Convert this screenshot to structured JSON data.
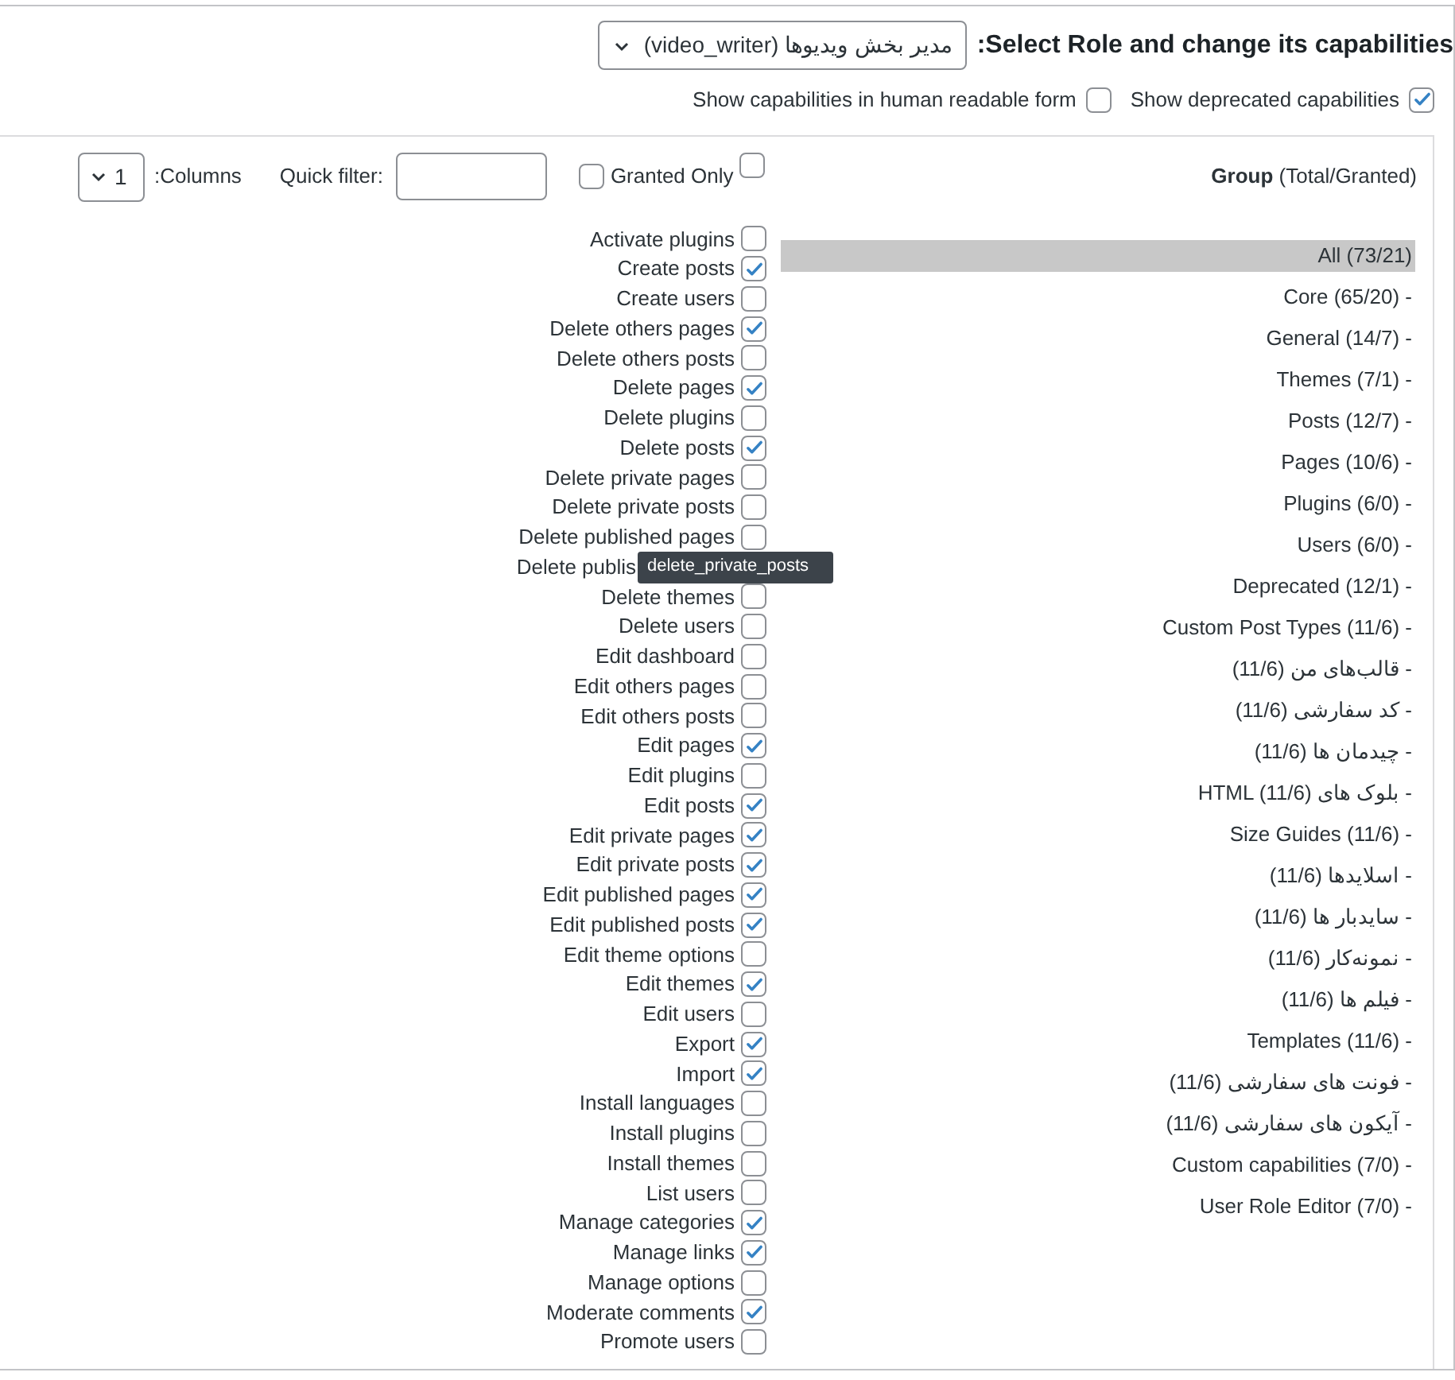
{
  "header": {
    "title": "Select Role and change its capabilities:",
    "role_select": {
      "value": "مدیر بخش ویدیوها (video_writer)"
    },
    "options": [
      {
        "label": "Show capabilities in human readable form",
        "checked": false
      },
      {
        "label": "Show deprecated capabilities",
        "checked": true
      }
    ]
  },
  "toolbar": {
    "group_heading": {
      "bold": "Group",
      "rest": "(Total/Granted)"
    },
    "column_checkbox": {
      "checked": false
    },
    "granted_only": {
      "label": "Granted Only",
      "checked": false
    },
    "quick_filter": {
      "label": "Quick filter:"
    },
    "columns": {
      "label": "Columns:",
      "value": "1"
    }
  },
  "groups": [
    {
      "label": "All (73/21)",
      "selected": true
    },
    {
      "label": "- Core (65/20)",
      "selected": false
    },
    {
      "label": "- General (14/7)",
      "selected": false
    },
    {
      "label": "- Themes (7/1)",
      "selected": false
    },
    {
      "label": "- Posts (12/7)",
      "selected": false
    },
    {
      "label": "- Pages (10/6)",
      "selected": false
    },
    {
      "label": "- Plugins (6/0)",
      "selected": false
    },
    {
      "label": "- Users (6/0)",
      "selected": false
    },
    {
      "label": "- Deprecated (12/1)",
      "selected": false
    },
    {
      "label": "- Custom Post Types (11/6)",
      "selected": false
    },
    {
      "label": "- قالب‌های من (11/6)",
      "selected": false
    },
    {
      "label": "- کد سفارشی (11/6)",
      "selected": false
    },
    {
      "label": "- چیدمان ها (11/6)",
      "selected": false
    },
    {
      "label": "- بلوک های HTML (11/6)",
      "selected": false
    },
    {
      "label": "- Size Guides (11/6)",
      "selected": false
    },
    {
      "label": "- اسلایدها (11/6)",
      "selected": false
    },
    {
      "label": "- سایدبار ها (11/6)",
      "selected": false
    },
    {
      "label": "- نمونه‌کار (11/6)",
      "selected": false
    },
    {
      "label": "- فیلم ها (11/6)",
      "selected": false
    },
    {
      "label": "- Templates (11/6)",
      "selected": false
    },
    {
      "label": "- فونت های سفارشی (11/6)",
      "selected": false
    },
    {
      "label": "- آیکون های سفارشی (11/6)",
      "selected": false
    },
    {
      "label": "- Custom capabilities (7/0)",
      "selected": false
    },
    {
      "label": "- User Role Editor (7/0)",
      "selected": false
    }
  ],
  "capabilities": [
    {
      "label": "Activate plugins",
      "checked": false
    },
    {
      "label": "Create posts",
      "checked": true
    },
    {
      "label": "Create users",
      "checked": false
    },
    {
      "label": "Delete others pages",
      "checked": true
    },
    {
      "label": "Delete others posts",
      "checked": false
    },
    {
      "label": "Delete pages",
      "checked": true
    },
    {
      "label": "Delete plugins",
      "checked": false
    },
    {
      "label": "Delete posts",
      "checked": true
    },
    {
      "label": "Delete private pages",
      "checked": false
    },
    {
      "label": "Delete private posts",
      "checked": false
    },
    {
      "label": "Delete published pages",
      "checked": false
    },
    {
      "label": "Delete publis",
      "tooltip": "delete_private_posts"
    },
    {
      "label": "Delete themes",
      "checked": false
    },
    {
      "label": "Delete users",
      "checked": false
    },
    {
      "label": "Edit dashboard",
      "checked": false
    },
    {
      "label": "Edit others pages",
      "checked": false
    },
    {
      "label": "Edit others posts",
      "checked": false
    },
    {
      "label": "Edit pages",
      "checked": true
    },
    {
      "label": "Edit plugins",
      "checked": false
    },
    {
      "label": "Edit posts",
      "checked": true
    },
    {
      "label": "Edit private pages",
      "checked": true
    },
    {
      "label": "Edit private posts",
      "checked": true
    },
    {
      "label": "Edit published pages",
      "checked": true
    },
    {
      "label": "Edit published posts",
      "checked": true
    },
    {
      "label": "Edit theme options",
      "checked": false
    },
    {
      "label": "Edit themes",
      "checked": true
    },
    {
      "label": "Edit users",
      "checked": false
    },
    {
      "label": "Export",
      "checked": true
    },
    {
      "label": "Import",
      "checked": true
    },
    {
      "label": "Install languages",
      "checked": false
    },
    {
      "label": "Install plugins",
      "checked": false
    },
    {
      "label": "Install themes",
      "checked": false
    },
    {
      "label": "List users",
      "checked": false
    },
    {
      "label": "Manage categories",
      "checked": true
    },
    {
      "label": "Manage links",
      "checked": true
    },
    {
      "label": "Manage options",
      "checked": false
    },
    {
      "label": "Moderate comments",
      "checked": true
    },
    {
      "label": "Promote users",
      "checked": false
    }
  ]
}
